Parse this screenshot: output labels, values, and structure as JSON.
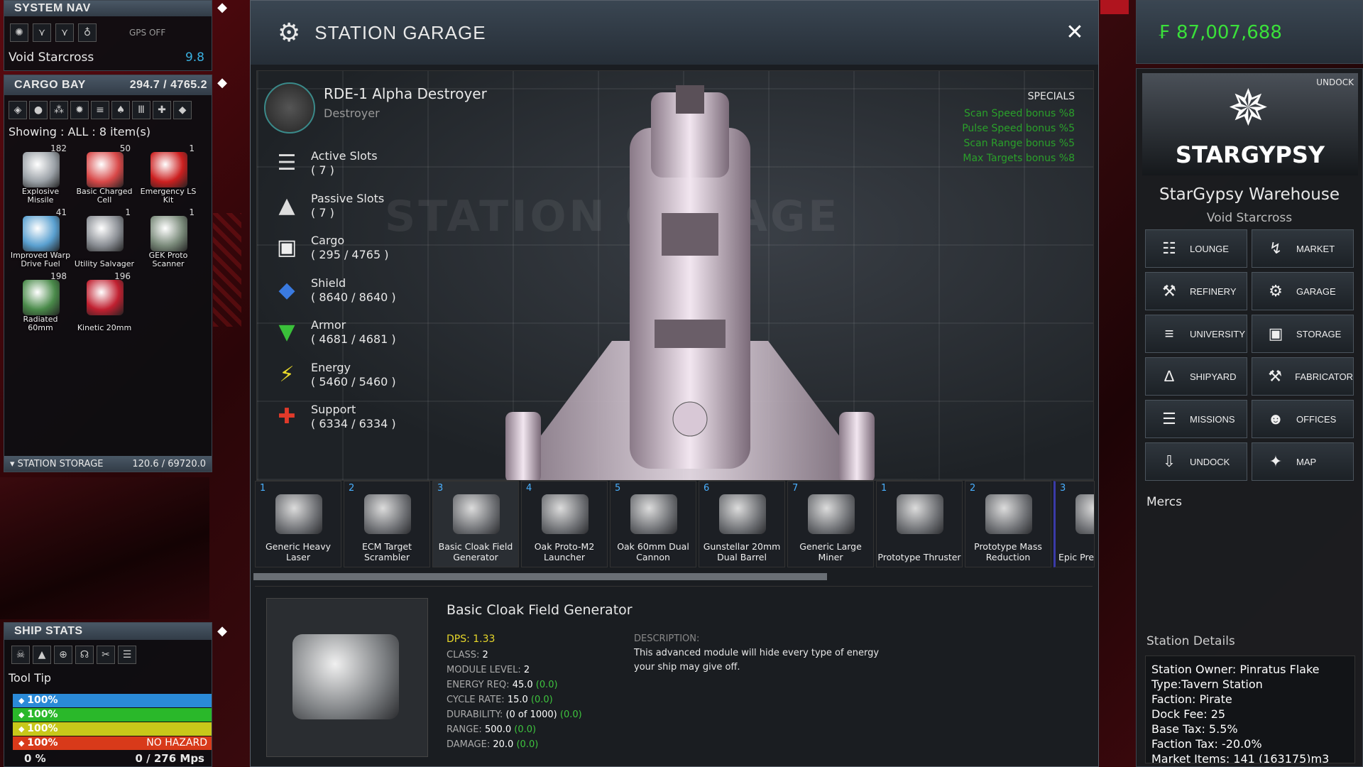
{
  "system_nav": {
    "title": "SYSTEM NAV",
    "gps": "GPS OFF",
    "system": "Void Starcross",
    "security": "9.8"
  },
  "cargo": {
    "title": "CARGO BAY",
    "capacity": "294.7 / 4765.2",
    "showing": "Showing : ALL : 8 item(s)",
    "items": [
      {
        "name": "Explosive Missile",
        "qty": "182",
        "color": "#9aa0a6"
      },
      {
        "name": "Basic Charged Cell",
        "qty": "50",
        "color": "#d84848"
      },
      {
        "name": "Emergency LS Kit",
        "qty": "1",
        "color": "#cc2020"
      },
      {
        "name": "Improved Warp Drive Fuel",
        "qty": "41",
        "color": "#5aa0d0"
      },
      {
        "name": "Utility Salvager",
        "qty": "1",
        "color": "#8a8e94"
      },
      {
        "name": "GEK Proto Scanner",
        "qty": "1",
        "color": "#7a8a7a"
      },
      {
        "name": "Radiated 60mm",
        "qty": "198",
        "color": "#4a8a4a"
      },
      {
        "name": "Kinetic 20mm",
        "qty": "196",
        "color": "#c02030"
      }
    ],
    "station_storage_label": "STATION STORAGE",
    "station_storage_value": "120.6 / 69720.0"
  },
  "ship_stats": {
    "title": "SHIP STATS",
    "tooltip": "Tool Tip",
    "bars": [
      {
        "value": "100%",
        "color": "#2a8ad8",
        "icon": "shield-icon"
      },
      {
        "value": "100%",
        "color": "#2ab82a",
        "icon": "armor-icon"
      },
      {
        "value": "100%",
        "color": "#c8c81a",
        "icon": "energy-icon"
      },
      {
        "value": "100%",
        "color": "#d83a1a",
        "icon": "support-icon",
        "hazard": "NO HAZARD"
      }
    ],
    "speed_pct": "0 %",
    "speed": "0  /  276 Mps"
  },
  "garage": {
    "title": "STATION GARAGE",
    "watermark": "STATION GARAGE",
    "ship_name": "RDE-1 Alpha Destroyer",
    "ship_class": "Destroyer",
    "stats": [
      {
        "label": "Active Slots",
        "value": "( 7 )",
        "icon": "active-slots-icon",
        "color": "#ddd",
        "glyph": "☰"
      },
      {
        "label": "Passive Slots",
        "value": "( 7 )",
        "icon": "passive-slots-icon",
        "color": "#ddd",
        "glyph": "▲"
      },
      {
        "label": "Cargo",
        "value": "( 295 / 4765 )",
        "icon": "cargo-icon",
        "color": "#eee",
        "glyph": "▣"
      },
      {
        "label": "Shield",
        "value": "( 8640 / 8640 )",
        "icon": "shield-icon",
        "color": "#3a7ae0",
        "glyph": "◆"
      },
      {
        "label": "Armor",
        "value": "( 4681 / 4681 )",
        "icon": "armor-icon",
        "color": "#3ac03a",
        "glyph": "▼"
      },
      {
        "label": "Energy",
        "value": "( 5460 / 5460 )",
        "icon": "energy-icon",
        "color": "#e8d82a",
        "glyph": "⚡"
      },
      {
        "label": "Support",
        "value": "( 6334 / 6334 )",
        "icon": "support-icon",
        "color": "#e03a2a",
        "glyph": "✚"
      }
    ],
    "specials_title": "SPECIALS",
    "specials": [
      "Scan Speed bonus %8",
      "Pulse Speed bonus %5",
      "Scan Range bonus %5",
      "Max Targets bonus %8"
    ],
    "modules": [
      {
        "n": "1",
        "name": "Generic Heavy Laser"
      },
      {
        "n": "2",
        "name": "ECM Target Scrambler"
      },
      {
        "n": "3",
        "name": "Basic Cloak Field Generator"
      },
      {
        "n": "4",
        "name": "Oak Proto-M2 Launcher"
      },
      {
        "n": "5",
        "name": "Oak 60mm Dual Cannon"
      },
      {
        "n": "6",
        "name": "Gunstellar 20mm Dual Barrel"
      },
      {
        "n": "7",
        "name": "Generic Large Miner"
      },
      {
        "n": "1",
        "name": "Prototype Thruster"
      },
      {
        "n": "2",
        "name": "Prototype Mass Reduction"
      },
      {
        "n": "3",
        "name": "Epic Prer Th"
      }
    ],
    "detail": {
      "name": "Basic Cloak Field Generator",
      "dps": "DPS: 1.33",
      "rows": [
        {
          "k": "CLASS:",
          "v": "2",
          "b": ""
        },
        {
          "k": "MODULE LEVEL:",
          "v": "2",
          "b": ""
        },
        {
          "k": "ENERGY REQ:",
          "v": "45.0",
          "b": "(0.0)"
        },
        {
          "k": "CYCLE RATE:",
          "v": "15.0",
          "b": "(0.0)"
        },
        {
          "k": "DURABILITY:",
          "v": "(0 of 1000)",
          "b": "(0.0)"
        },
        {
          "k": "RANGE:",
          "v": "500.0",
          "b": "(0.0)"
        },
        {
          "k": "DAMAGE:",
          "v": "20.0",
          "b": "(0.0)"
        }
      ],
      "desc_title": "DESCRIPTION:",
      "desc": "This advanced module will hide every type of energy your ship may give off."
    }
  },
  "right": {
    "credits": "87,007,688",
    "credit_symbol": "₣",
    "undock_top": "UNDOCK",
    "logo": "STARGYPSY",
    "station": "StarGypsy Warehouse",
    "system": "Void Starcross",
    "nav": [
      {
        "label": "LOUNGE",
        "icon": "lounge-icon",
        "glyph": "☷"
      },
      {
        "label": "MARKET",
        "icon": "market-icon",
        "glyph": "↯"
      },
      {
        "label": "REFINERY",
        "icon": "refinery-icon",
        "glyph": "⚒"
      },
      {
        "label": "GARAGE",
        "icon": "garage-icon",
        "glyph": "⚙"
      },
      {
        "label": "UNIVERSITY",
        "icon": "university-icon",
        "glyph": "≡"
      },
      {
        "label": "STORAGE",
        "icon": "storage-icon",
        "glyph": "▣"
      },
      {
        "label": "SHIPYARD",
        "icon": "shipyard-icon",
        "glyph": "∆"
      },
      {
        "label": "FABRICATOR",
        "icon": "fabricator-icon",
        "glyph": "⚒"
      },
      {
        "label": "MISSIONS",
        "icon": "missions-icon",
        "glyph": "☰"
      },
      {
        "label": "OFFICES",
        "icon": "offices-icon",
        "glyph": "☻"
      },
      {
        "label": "UNDOCK",
        "icon": "undock-icon",
        "glyph": "⇩"
      },
      {
        "label": "MAP",
        "icon": "map-icon",
        "glyph": "✦"
      }
    ],
    "mercs": "Mercs",
    "details_title": "Station Details",
    "details": [
      "Station Owner: Pinratus Flake",
      "Type:Tavern Station",
      "Faction: Pirate",
      "Dock Fee: 25",
      "Base Tax: 5.5%",
      "Faction Tax: -20.0%",
      "Market Items: 141 (163175)m3"
    ]
  }
}
